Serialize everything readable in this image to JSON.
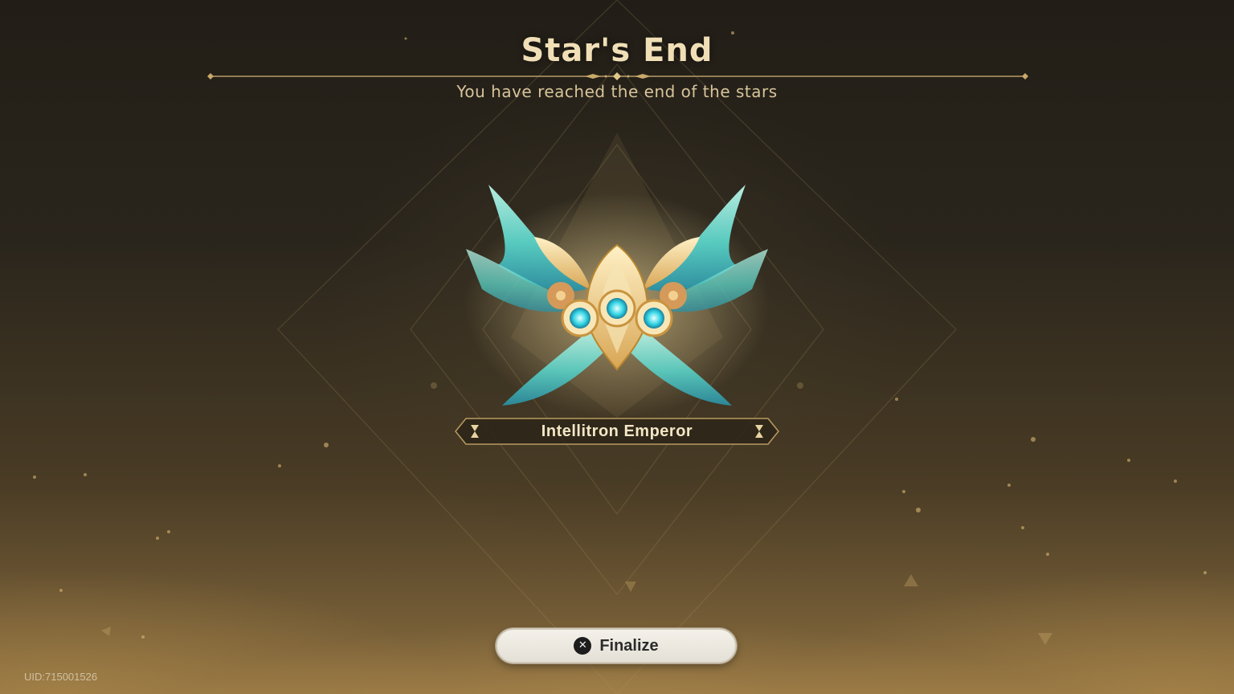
{
  "screen": {
    "title": "Star's End",
    "subtitle": "You have reached the end of the stars"
  },
  "reward": {
    "name": "Intellitron Emperor",
    "emblem_icon": "winged-gear-emblem-icon"
  },
  "actions": {
    "finalize_label": "Finalize",
    "finalize_button_glyph": "✕",
    "finalize_icon": "cross-button-icon"
  },
  "footer": {
    "uid": "UID:715001526"
  },
  "colors": {
    "title": "#f0dfb6",
    "accent_gold": "#c9a96a",
    "emblem_teal": "#6fe3d6",
    "button_bg": "#eeeae0"
  }
}
